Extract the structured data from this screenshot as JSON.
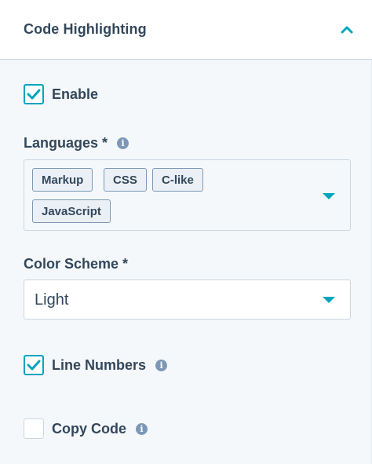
{
  "panel": {
    "title": "Code Highlighting",
    "toggle_icon": "chevron-up-icon"
  },
  "enable": {
    "label": "Enable",
    "checked": true
  },
  "languages": {
    "label": "Languages *",
    "has_info": true,
    "selected": [
      "Markup",
      "CSS",
      "C-like",
      "JavaScript"
    ]
  },
  "color_scheme": {
    "label": "Color Scheme *",
    "value": "Light"
  },
  "line_numbers": {
    "label": "Line Numbers",
    "checked": true,
    "has_info": true
  },
  "copy_code": {
    "label": "Copy Code",
    "checked": false,
    "has_info": true
  },
  "colors": {
    "accent": "#00a4bd",
    "text": "#33475b",
    "border": "#cbd6e2",
    "background": "#f5f8fa"
  }
}
